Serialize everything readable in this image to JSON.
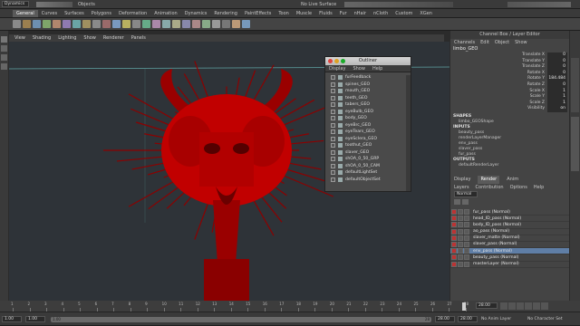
{
  "topbar": {
    "mode": "Dynamics",
    "objects_label": "Objects",
    "live_surface": "No Live Surface"
  },
  "shelf_tabs": [
    "General",
    "Curves",
    "Surfaces",
    "Polygons",
    "Deformation",
    "Animation",
    "Dynamics",
    "Rendering",
    "PaintEffects",
    "Toon",
    "Muscle",
    "Fluids",
    "Fur",
    "nHair",
    "nCloth",
    "Custom",
    "XGen"
  ],
  "active_shelf": "General",
  "panel_menu": [
    "View",
    "Shading",
    "Lighting",
    "Show",
    "Renderer",
    "Panels"
  ],
  "outliner": {
    "title": "Outliner",
    "menu": [
      "Display",
      "Show",
      "Help"
    ],
    "items": [
      "furFeedback",
      "spines_GEO",
      "mouth_GEO",
      "teeth_GEO",
      "tabers_GEO",
      "eyeBulb_GEO",
      "body_GEO",
      "eyeBrc_GEO",
      "eyeTears_GEO",
      "eyeSclera_GEO",
      "toothut_GEO",
      "slaver_GEO",
      "shOA_0_50_GRP",
      "shOA_0_50_CAM",
      "defaultLightSet",
      "defaultObjectSet"
    ]
  },
  "channel_box": {
    "header": "Channel Box / Layer Editor",
    "menu": [
      "Channels",
      "Edit",
      "Object",
      "Show"
    ],
    "object": "limbo_GEO",
    "channels": [
      {
        "name": "Translate X",
        "value": "0"
      },
      {
        "name": "Translate Y",
        "value": "0"
      },
      {
        "name": "Translate Z",
        "value": "0"
      },
      {
        "name": "Rotate X",
        "value": "0"
      },
      {
        "name": "Rotate Y",
        "value": "184.484"
      },
      {
        "name": "Rotate Z",
        "value": "0"
      },
      {
        "name": "Scale X",
        "value": "1"
      },
      {
        "name": "Scale Y",
        "value": "1"
      },
      {
        "name": "Scale Z",
        "value": "1"
      },
      {
        "name": "Visibility",
        "value": "on"
      }
    ],
    "shapes_label": "SHAPES",
    "shapes": [
      "limbo_GEOShape"
    ],
    "inputs_label": "INPUTS",
    "inputs": [
      "beauty_pass",
      "renderLayerManager",
      "env_pass",
      "slaver_pass",
      "fur_pass"
    ],
    "outputs_label": "OUTPUTS",
    "outputs": [
      "defaultRenderLayer"
    ]
  },
  "layer_editor": {
    "tabs": [
      "Display",
      "Render",
      "Anim"
    ],
    "active_tab": "Render",
    "menu": [
      "Layers",
      "Contribution",
      "Options",
      "Help"
    ],
    "blend_mode": "Normal",
    "layers": [
      {
        "name": "fur_pass (Normal)",
        "selected": false
      },
      {
        "name": "head_ID_pass (Normal)",
        "selected": false
      },
      {
        "name": "body_ID_pass (Normal)",
        "selected": false
      },
      {
        "name": "ao_pass (Normal)",
        "selected": false
      },
      {
        "name": "slaver_matte (Normal)",
        "selected": false
      },
      {
        "name": "slaver_pass (Normal)",
        "selected": false
      },
      {
        "name": "env_pass (Normal)",
        "selected": true
      },
      {
        "name": "beauty_pass (Normal)",
        "selected": false
      },
      {
        "name": "masterLayer (Normal)",
        "selected": false
      }
    ]
  },
  "right_tabs": [
    "Attribute Editor",
    "Channel Box / Layer Editor"
  ],
  "timeline": {
    "ticks": [
      "1",
      "2",
      "3",
      "4",
      "5",
      "6",
      "7",
      "8",
      "9",
      "10",
      "11",
      "12",
      "13",
      "14",
      "15",
      "16",
      "17",
      "18",
      "19",
      "20",
      "21",
      "22",
      "23",
      "24",
      "25",
      "26",
      "27",
      "28"
    ],
    "current_frame": "28.00",
    "start": "1.00",
    "range_start": "1.00",
    "range_end": "28",
    "end": "28.00",
    "end2": "28.00",
    "anim_layer": "No Anim Layer",
    "char_set": "No Character Set"
  },
  "colors": {
    "model": "#c10000",
    "selected_layer": "#5f7ea6"
  }
}
